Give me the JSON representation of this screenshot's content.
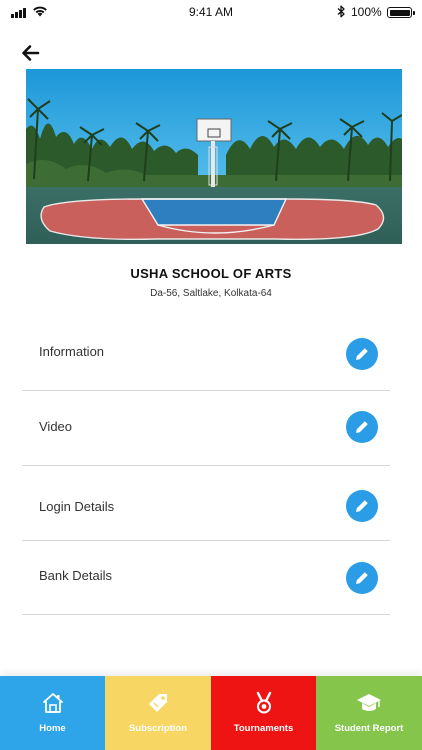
{
  "status_bar": {
    "time": "9:41 AM",
    "battery": "100%"
  },
  "school": {
    "name": "USHA SCHOOL OF ARTS",
    "address": "Da-56, Saltlake, Kolkata-64"
  },
  "menu": [
    {
      "label": "Information"
    },
    {
      "label": "Video"
    },
    {
      "label": "Login Details"
    },
    {
      "label": "Bank Details"
    }
  ],
  "bottom_nav": [
    {
      "label": "Home",
      "icon": "home-icon",
      "color": "#2ea5e8"
    },
    {
      "label": "Subscription",
      "icon": "tag-icon",
      "color": "#f7d663"
    },
    {
      "label": "Tournaments",
      "icon": "medal-icon",
      "color": "#ee1414"
    },
    {
      "label": "Student Report",
      "icon": "graduation-cap-icon",
      "color": "#86c54c"
    }
  ],
  "colors": {
    "accent": "#2b9de6"
  }
}
